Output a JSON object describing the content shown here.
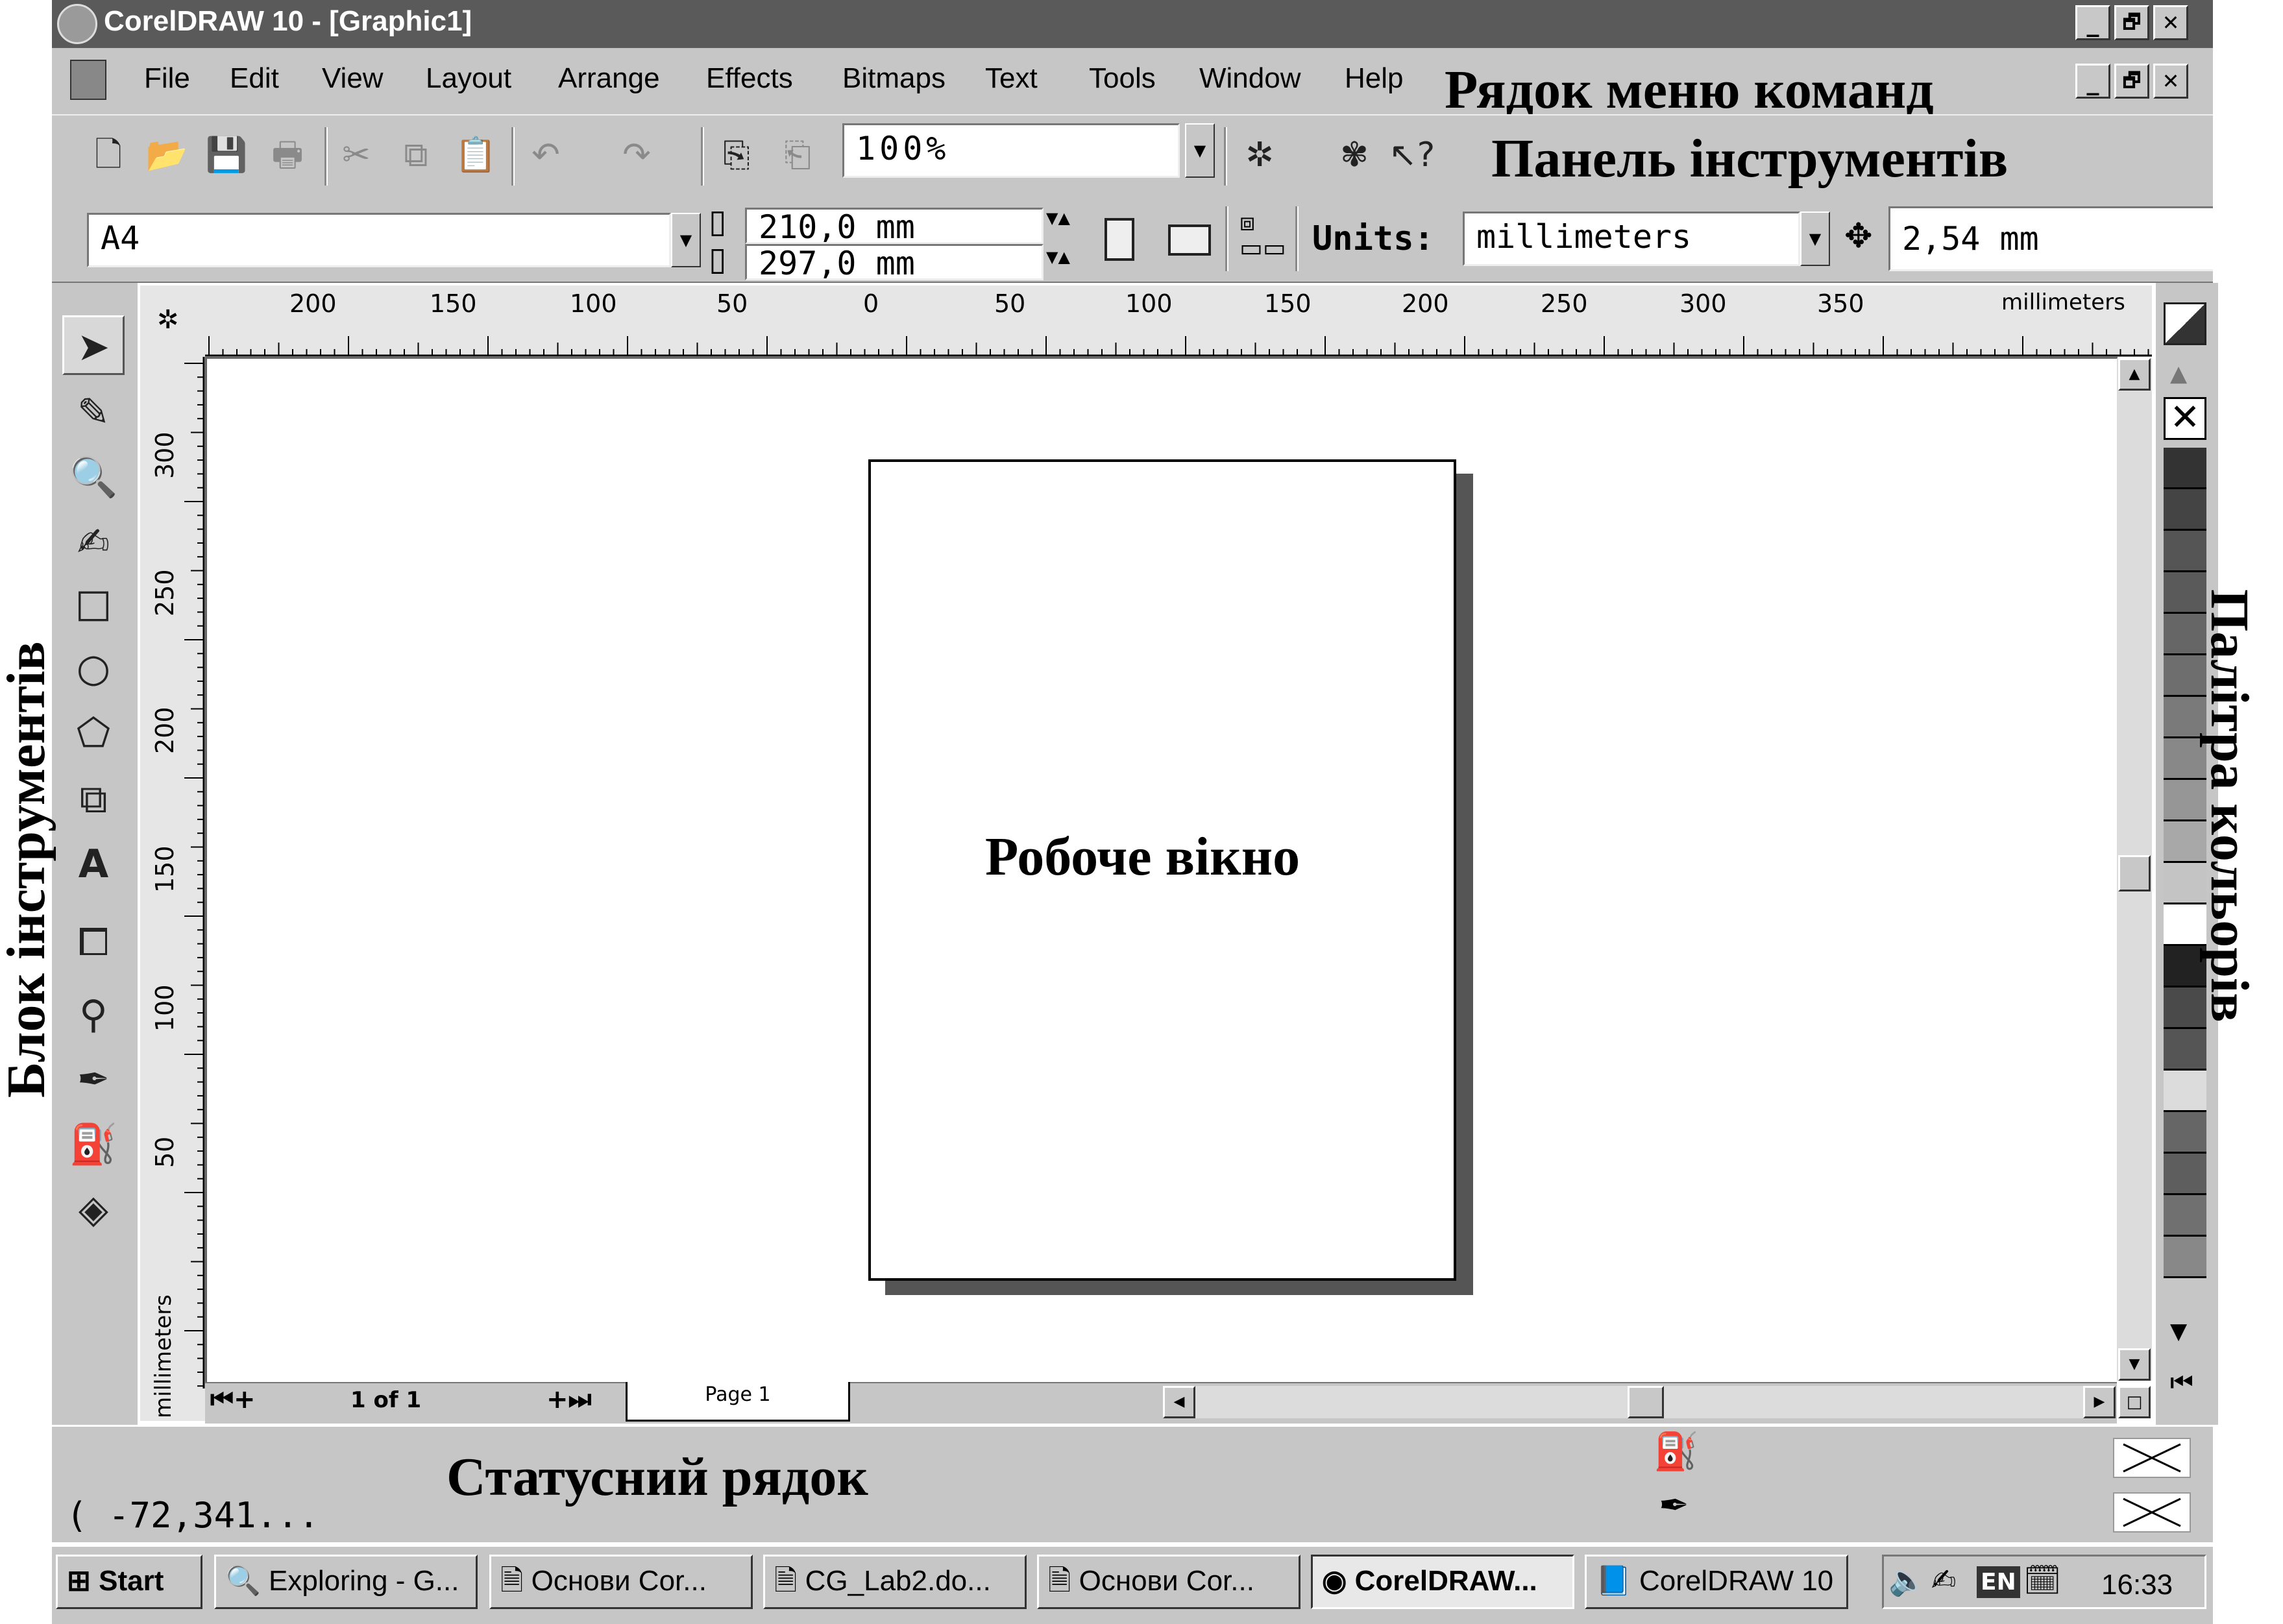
{
  "window": {
    "title": "CorelDRAW 10 - [Graphic1]",
    "minimize": "_",
    "restore": "🗗",
    "close": "✕"
  },
  "menu": {
    "items": [
      "File",
      "Edit",
      "View",
      "Layout",
      "Arrange",
      "Effects",
      "Bitmaps",
      "Text",
      "Tools",
      "Window",
      "Help"
    ]
  },
  "toolbar": {
    "zoom_value": "100%",
    "icons": [
      "new-icon",
      "open-icon",
      "save-icon",
      "print-icon",
      "cut-icon",
      "copy-icon",
      "paste-icon",
      "undo-icon",
      "redo-icon",
      "import-icon",
      "export-icon",
      "app-launcher-icon",
      "corel-online-icon",
      "whats-this-icon"
    ]
  },
  "property_bar": {
    "paper_size": "A4",
    "width": "210,0 mm",
    "height": "297,0 mm",
    "units_label": "Units:",
    "units_value": "millimeters",
    "nudge": "2,54 mm"
  },
  "toolbox": {
    "tools": [
      "pick-tool",
      "shape-tool",
      "zoom-tool",
      "freehand-tool",
      "rectangle-tool",
      "ellipse-tool",
      "polygon-tool",
      "basic-shapes-tool",
      "text-tool",
      "interactive-blend-tool",
      "eyedropper-tool",
      "outline-tool",
      "fill-tool",
      "interactive-fill-tool"
    ]
  },
  "rulers": {
    "horizontal_ticks": [
      "200",
      "150",
      "100",
      "50",
      "0",
      "50",
      "100",
      "150",
      "200",
      "250",
      "300",
      "350"
    ],
    "horizontal_unit": "millimeters",
    "vertical_ticks": [
      "300",
      "250",
      "200",
      "150",
      "100",
      "50"
    ],
    "vertical_unit": "millimeters"
  },
  "document": {
    "page_tab": "Page 1",
    "page_counter": "1 of 1"
  },
  "palette": {
    "colors": [
      "#333333",
      "#444444",
      "#555555",
      "#5a5a5a",
      "#666666",
      "#6e6e6e",
      "#7a7a7a",
      "#888888",
      "#969696",
      "#a8a8a8",
      "#c4c4c4",
      "#ffffff",
      "#222222",
      "#4a4a4a",
      "#555555",
      "#dcdcdc",
      "#666666",
      "#5e5e5e",
      "#707070",
      "#888888"
    ]
  },
  "status": {
    "coords": "( -72,341...",
    "fill_icon": "fill-bucket-icon",
    "outline_icon": "pen-nib-icon"
  },
  "annotations": {
    "menu_bar": "Рядок меню команд",
    "toolbar": "Панель інструментів",
    "work_window": "Робоче вікно",
    "toolbox": "Блок інструментів",
    "palette": "Палітра кольорів",
    "status_bar": "Статусний рядок"
  },
  "taskbar": {
    "start": "Start",
    "buttons": [
      "Exploring - G...",
      "Основи Cor...",
      "CG_Lab2.do...",
      "Основи Cor...",
      "CorelDRAW...",
      "CorelDRAW 10"
    ],
    "language": "EN",
    "clock": "16:33"
  }
}
